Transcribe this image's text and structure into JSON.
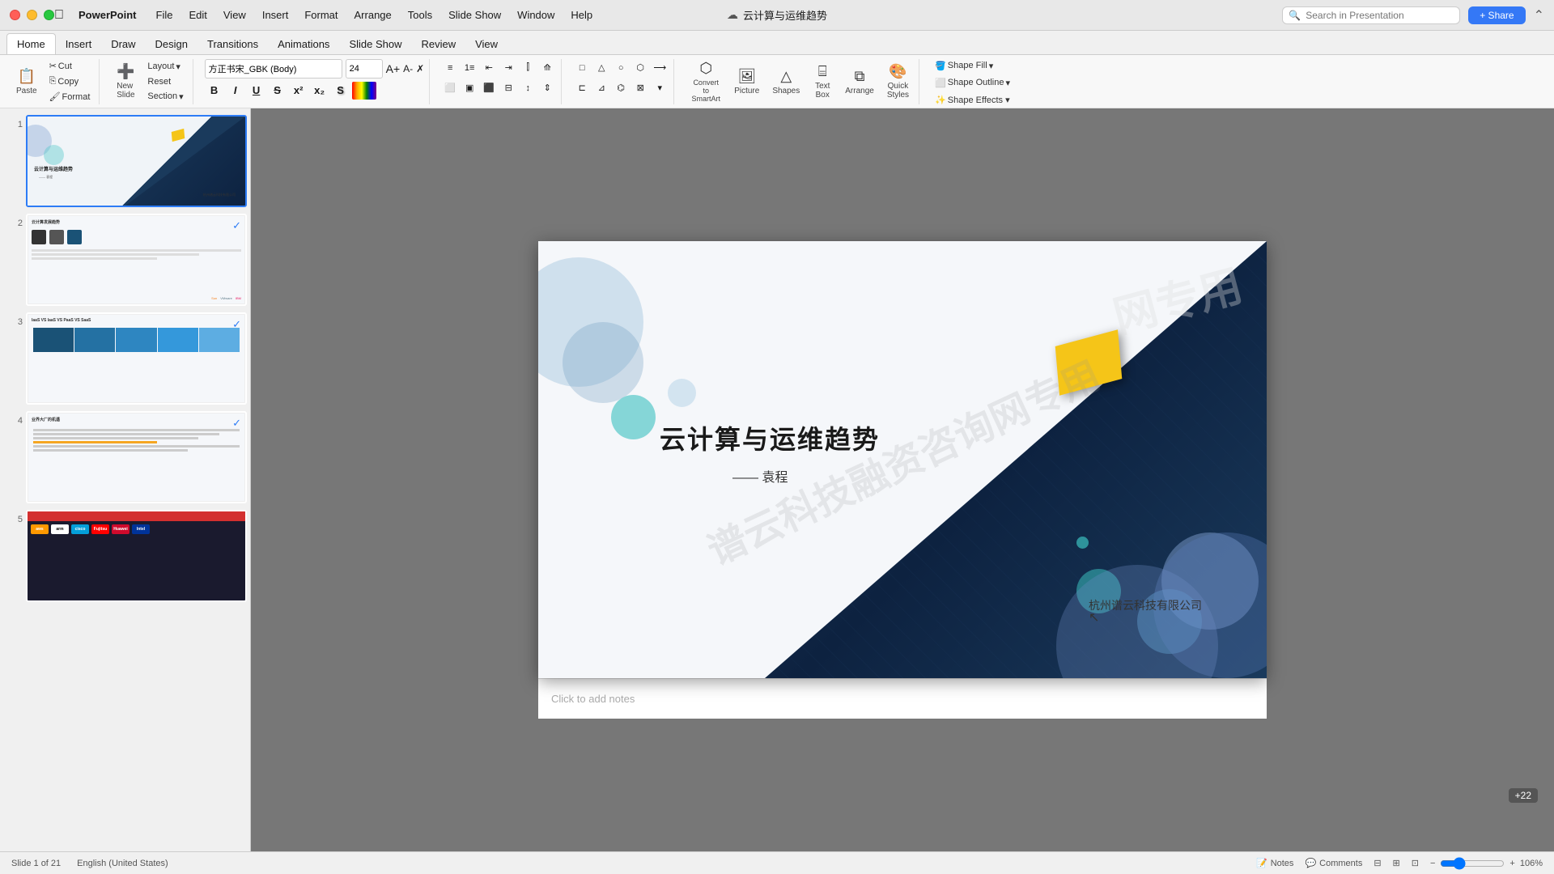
{
  "app": {
    "name": "PowerPoint",
    "title": "云计算与运维趋势",
    "apple_symbol": ""
  },
  "titlebar": {
    "menus": [
      "File",
      "Edit",
      "View",
      "Insert",
      "Format",
      "Arrange",
      "Tools",
      "Slide Show",
      "Window",
      "Help"
    ],
    "search_placeholder": "Search in Presentation",
    "share_label": "+ Share",
    "title": "云计算与运维趋势"
  },
  "ribbon": {
    "tabs": [
      "Home",
      "Insert",
      "Draw",
      "Design",
      "Transitions",
      "Animations",
      "Slide Show",
      "Review",
      "View"
    ],
    "active_tab": "Home"
  },
  "toolbar": {
    "paste_label": "Paste",
    "cut_label": "Cut",
    "copy_label": "Copy",
    "format_label": "Format",
    "layout_label": "Layout",
    "reset_label": "Reset",
    "section_label": "Section",
    "new_slide_label": "New\nSlide",
    "font_name": "方正书宋_GBK (Body)",
    "font_size": "24",
    "bold": "B",
    "italic": "I",
    "underline": "U",
    "strikethrough": "S",
    "superscript": "x²",
    "subscript": "x₂",
    "picture_label": "Picture",
    "shapes_label": "Shapes",
    "textbox_label": "Text\nBox",
    "arrange_label": "Arrange",
    "quick_styles_label": "Quick\nStyles",
    "shape_fill_label": "Shape Fill",
    "shape_outline_label": "Shape Outline",
    "convert_to_smartart_label": "Convert to\nSmartArt"
  },
  "slides": [
    {
      "number": "1",
      "selected": true,
      "starred": false,
      "checked": false,
      "type": "title"
    },
    {
      "number": "2",
      "selected": false,
      "starred": true,
      "checked": true,
      "type": "content"
    },
    {
      "number": "3",
      "selected": false,
      "starred": false,
      "checked": true,
      "type": "table"
    },
    {
      "number": "4",
      "selected": false,
      "starred": false,
      "checked": true,
      "type": "text"
    },
    {
      "number": "5",
      "selected": false,
      "starred": false,
      "checked": false,
      "type": "logos"
    }
  ],
  "main_slide": {
    "title": "云计算与运维趋势",
    "author": "—— 袁程",
    "company": "杭州谱云科技有限公司",
    "watermark": "谱云科技融资咨询网专用",
    "watermark_top": "网专用"
  },
  "notes": {
    "placeholder": "Click to add notes",
    "label": "Notes"
  },
  "statusbar": {
    "slide_info": "Slide 1 of 21",
    "language": "English (United States)",
    "notes_label": "Notes",
    "comments_label": "Comments",
    "zoom_level": "106%",
    "plus22": "+22"
  }
}
